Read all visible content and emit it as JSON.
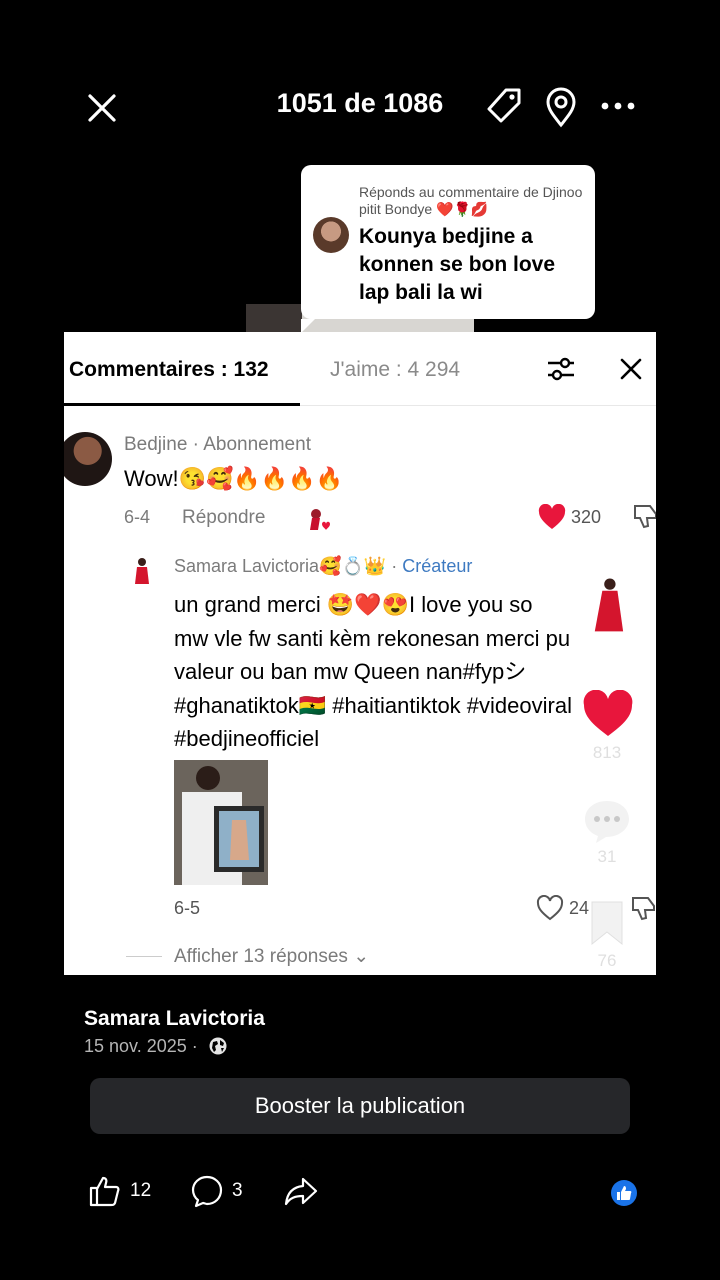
{
  "header": {
    "counter": "1051 de 1086"
  },
  "reply_bubble": {
    "caption": "Réponds au commentaire de Djinoo pitit Bondye ❤️🌹💋",
    "text": "Kounya bedjine a konnen se bon love lap bali la wi"
  },
  "comments_panel": {
    "tab_comments": "Commentaires : 132",
    "tab_likes": "J'aime : 4 294",
    "comment1": {
      "author": "Bedjine · Abonnement",
      "text": "Wow!😘🥰🔥🔥🔥🔥",
      "date": "6-4",
      "reply_label": "Répondre",
      "likes": "320"
    },
    "comment2": {
      "author": "Samara Lavictoria🥰💍👑 · ",
      "creator_label": "Créateur",
      "text_lines": [
        "un grand merci 🤩❤️😍I love you so",
        "mw vle fw santi kèm rekonesan merci pu",
        "valeur ou ban mw Queen nan#fypシ",
        "#ghanatiktok🇬🇭 #haitiantiktok #videoviral",
        "#bedjineofficiel"
      ],
      "date": "6-5",
      "likes": "24",
      "more_replies": "Afficher 13 réponses ⌄"
    }
  },
  "rail": {
    "likes": "813",
    "comments": "31",
    "saves": "76"
  },
  "post": {
    "author": "Samara Lavictoria",
    "date": "15 nov. 2025 ·",
    "boost_label": "Booster la publication"
  },
  "actions": {
    "like_count": "12",
    "comment_count": "3"
  },
  "colors": {
    "background": "#000000",
    "heart_red": "#e8163c",
    "creator_blue": "#3e7ac1",
    "like_badge_blue": "#1a73e8",
    "boost_button": "#26272a"
  }
}
